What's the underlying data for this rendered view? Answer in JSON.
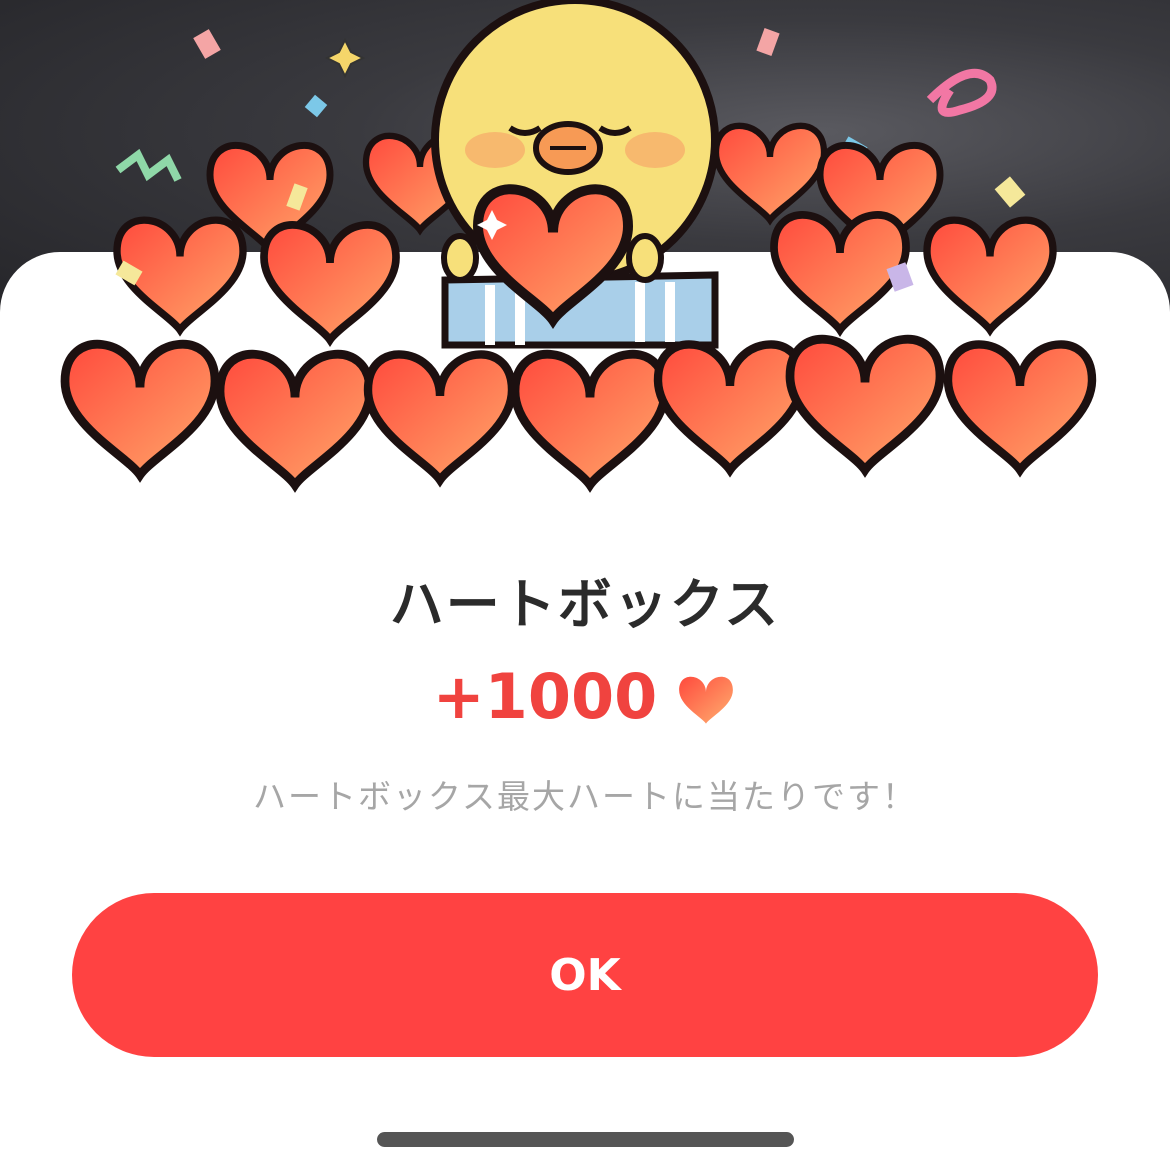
{
  "dialog": {
    "title": "ハートボックス",
    "reward_amount": "+1000",
    "reward_icon": "heart-icon",
    "message": "ハートボックス最大ハートに当たりです！",
    "ok_label": "OK"
  },
  "colors": {
    "accent": "#ff4242",
    "reward_text": "#f0433f",
    "heart_top": "#ff4a3d",
    "heart_bottom": "#ffa86a",
    "chick": "#f7e07a"
  }
}
